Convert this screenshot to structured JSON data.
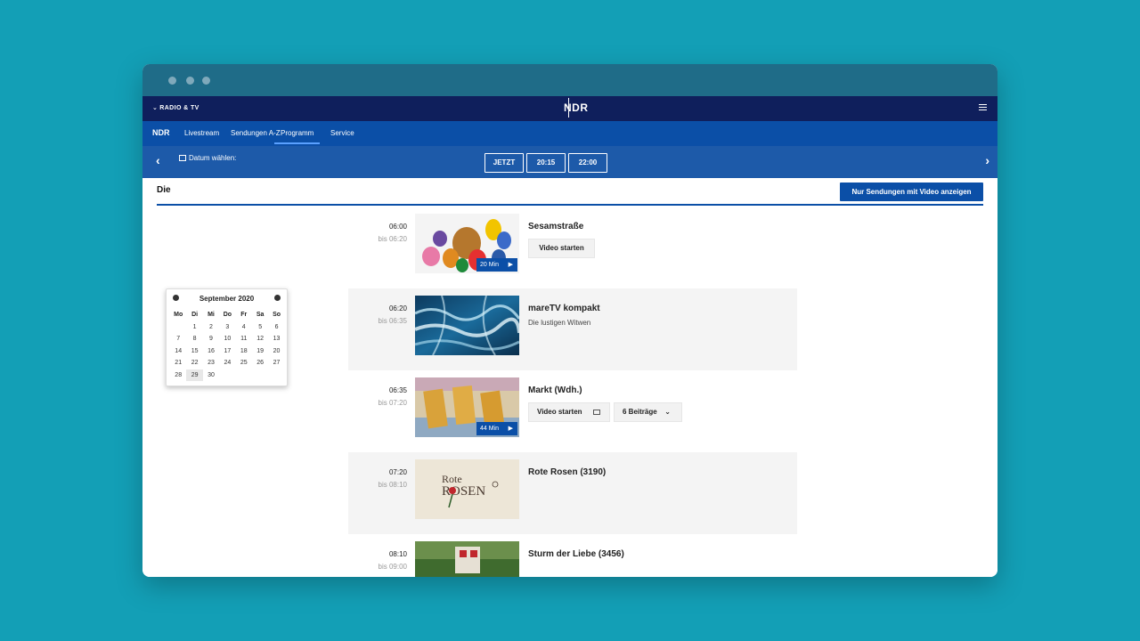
{
  "header": {
    "section_label": "RADIO & TV",
    "logo": "NDR"
  },
  "nav": {
    "logo": "NDR",
    "items": [
      "Livestream",
      "Sendungen A-Z",
      "Programm",
      "Service"
    ],
    "active": "Programm"
  },
  "datebar": {
    "date_label": "Datum wählen:",
    "buttons": [
      "JETZT",
      "20:15",
      "22:00"
    ]
  },
  "content": {
    "day_label": "Die",
    "video_filter_button": "Nur Sendungen mit Video anzeigen"
  },
  "calendar": {
    "month": "September 2020",
    "weekdays": [
      "Mo",
      "Di",
      "Mi",
      "Do",
      "Fr",
      "Sa",
      "So"
    ],
    "weeks": [
      [
        "",
        "1",
        "2",
        "3",
        "4",
        "5",
        "6"
      ],
      [
        "7",
        "8",
        "9",
        "10",
        "11",
        "12",
        "13"
      ],
      [
        "14",
        "15",
        "16",
        "17",
        "18",
        "19",
        "20"
      ],
      [
        "21",
        "22",
        "23",
        "24",
        "25",
        "26",
        "27"
      ],
      [
        "28",
        "29",
        "30",
        "",
        "",
        "",
        ""
      ]
    ],
    "selected": "29"
  },
  "programs": [
    {
      "start": "06:00",
      "end": "bis 06:20",
      "title": "Sesamstraße",
      "subtitle": "",
      "video_button": "Video starten",
      "duration": "20 Min"
    },
    {
      "start": "06:20",
      "end": "bis 06:35",
      "title": "mareTV kompakt",
      "subtitle": "Die lustigen Witwen"
    },
    {
      "start": "06:35",
      "end": "bis 07:20",
      "title": "Markt (Wdh.)",
      "video_button": "Video starten",
      "contributions_button": "6 Beiträge",
      "duration": "44 Min"
    },
    {
      "start": "07:20",
      "end": "bis 08:10",
      "title": "Rote Rosen (3190)",
      "thumb_text_1": "Rote",
      "thumb_text_2": "ROSEN"
    },
    {
      "start": "08:10",
      "end": "bis 09:00",
      "title": "Sturm der Liebe (3456)"
    }
  ],
  "colors": {
    "background": "#139fb6",
    "header_dark": "#0f1f5c",
    "nav_blue": "#0b4fa7",
    "datebar_blue": "#1d5aa9"
  }
}
